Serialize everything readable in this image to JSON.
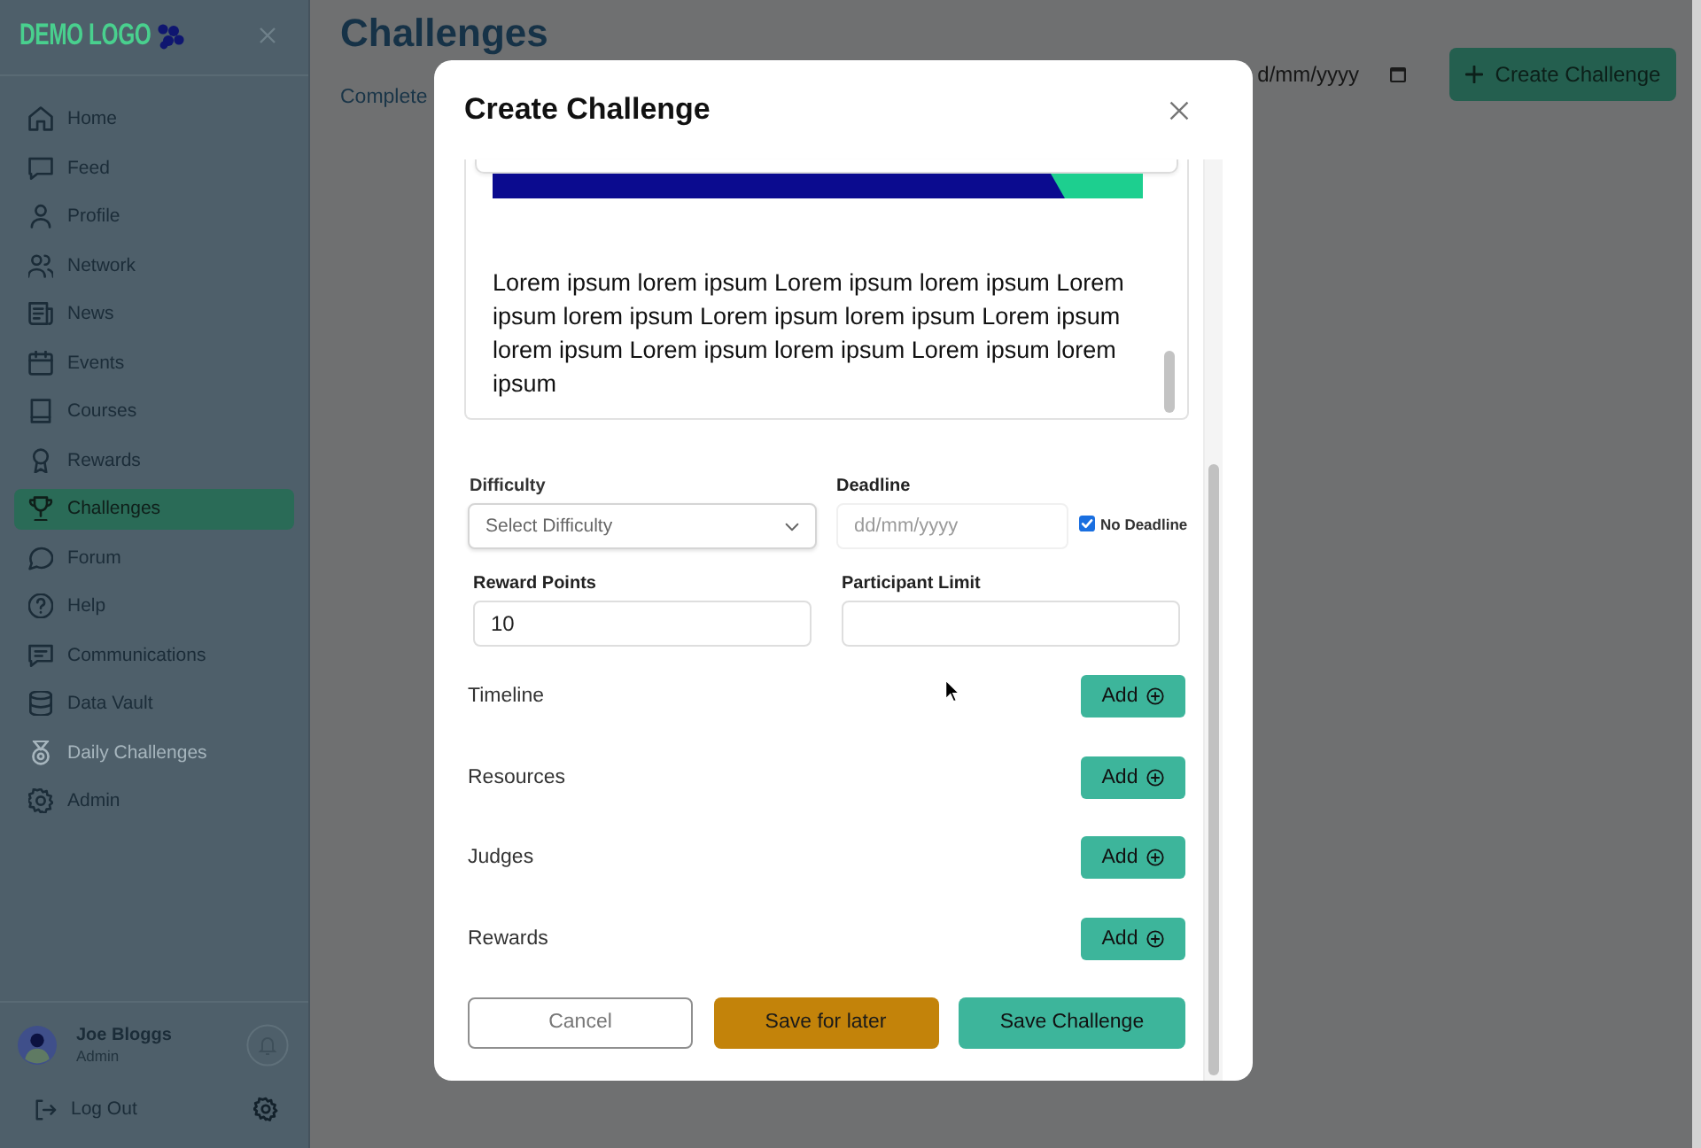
{
  "sidebar": {
    "logo": "DEMO LOGO",
    "items": [
      {
        "label": "Home",
        "selected": false,
        "disabled": false
      },
      {
        "label": "Feed",
        "selected": false,
        "disabled": false
      },
      {
        "label": "Profile",
        "selected": false,
        "disabled": false
      },
      {
        "label": "Network",
        "selected": false,
        "disabled": false
      },
      {
        "label": "News",
        "selected": false,
        "disabled": false
      },
      {
        "label": "Events",
        "selected": false,
        "disabled": false
      },
      {
        "label": "Courses",
        "selected": false,
        "disabled": false
      },
      {
        "label": "Rewards",
        "selected": false,
        "disabled": false
      },
      {
        "label": "Challenges",
        "selected": true,
        "disabled": false
      },
      {
        "label": "Forum",
        "selected": false,
        "disabled": false
      },
      {
        "label": "Help",
        "selected": false,
        "disabled": false
      },
      {
        "label": "Communications",
        "selected": false,
        "disabled": false
      },
      {
        "label": "Data Vault",
        "selected": false,
        "disabled": false
      },
      {
        "label": "Daily Challenges",
        "selected": false,
        "disabled": true
      },
      {
        "label": "Admin",
        "selected": false,
        "disabled": false
      }
    ],
    "user": {
      "name": "Joe Bloggs",
      "role": "Admin"
    },
    "logout": "Log Out"
  },
  "page": {
    "title": "Challenges",
    "subtitle": "Complete",
    "date_filter": {
      "value": "d/mm/yyyy"
    },
    "create_button": "Create Challenge"
  },
  "modal": {
    "title": "Create Challenge",
    "editor": {
      "text": "Lorem ipsum lorem ipsum Lorem ipsum lorem ipsum Lorem ipsum lorem ipsum Lorem ipsum lorem ipsum Lorem ipsum lorem ipsum Lorem ipsum lorem ipsum Lorem ipsum lorem ipsum"
    },
    "fields": [
      {
        "kind": "select",
        "label": "Difficulty",
        "placeholder": "Select Difficulty"
      },
      {
        "kind": "date",
        "label": "Deadline",
        "placeholder": "dd/mm/yyyy",
        "disabled": true,
        "option": {
          "label": "No Deadline",
          "checked": true
        }
      },
      {
        "kind": "number",
        "label": "Reward Points",
        "value": "10"
      },
      {
        "kind": "number",
        "label": "Participant Limit"
      }
    ],
    "sections": [
      {
        "label": "Timeline",
        "button": "Add"
      },
      {
        "label": "Resources",
        "button": "Add"
      },
      {
        "label": "Judges",
        "button": "Add"
      },
      {
        "label": "Rewards",
        "button": "Add"
      }
    ],
    "buttons": [
      {
        "label": "Cancel",
        "kind": "outline"
      },
      {
        "label": "Save for later",
        "kind": "warning"
      },
      {
        "label": "Save Challenge",
        "kind": "primary"
      }
    ]
  }
}
